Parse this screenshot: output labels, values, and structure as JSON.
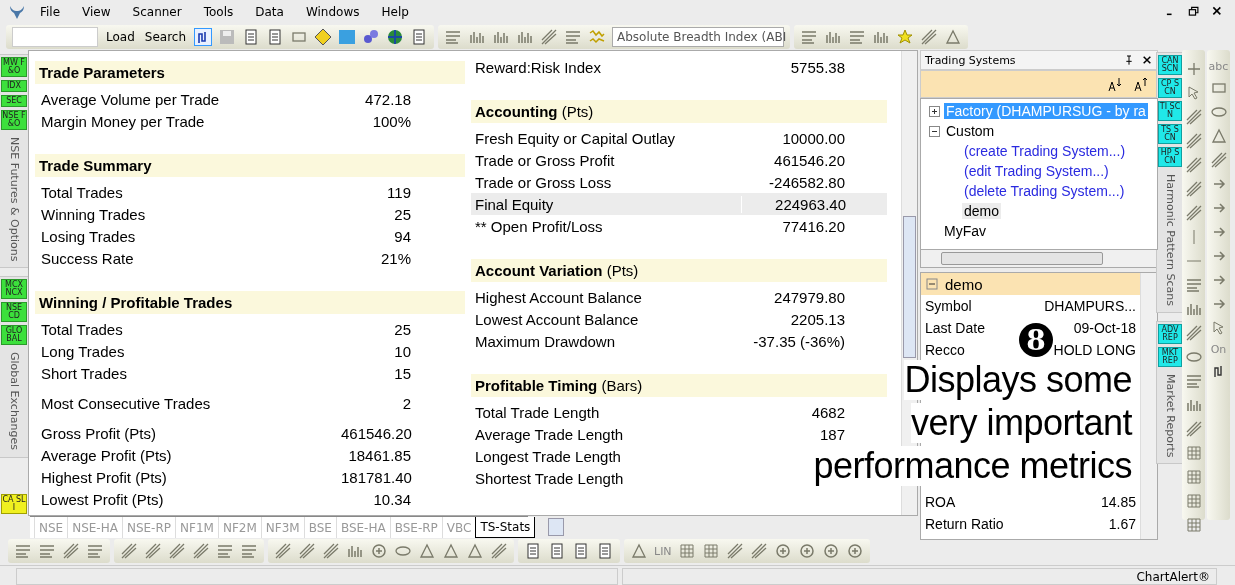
{
  "menu": {
    "items": [
      "File",
      "View",
      "Scanner",
      "Tools",
      "Data",
      "Windows",
      "Help"
    ]
  },
  "toolbar": {
    "buttons": [
      "Load",
      "Search"
    ],
    "indicator_dropdown": {
      "value": "Absolute Breadth Index (ABI"
    }
  },
  "left_strip": {
    "groups": [
      {
        "badges": [
          "MW F&O",
          "IDX",
          "SEC",
          "NSE F&O"
        ],
        "label": "NSE Futures & Options"
      },
      {
        "badges": [
          "MCX NCX",
          "NSE CD",
          "GLO BAL"
        ],
        "label": "Global Exchanges"
      }
    ],
    "bottom_badge": "CA SLI"
  },
  "stats": {
    "left": [
      {
        "title": "Trade Parameters",
        "groups": [
          [
            {
              "label": "Average Volume per Trade",
              "value": "472.18",
              "highlighted": false
            },
            {
              "label": "Margin Money per Trade",
              "value": "100%",
              "highlighted": false
            }
          ]
        ]
      },
      {
        "title": "Trade Summary",
        "groups": [
          [
            {
              "label": "Total Trades",
              "value": "119",
              "highlighted": false
            },
            {
              "label": "Winning Trades",
              "value": "25",
              "highlighted": false
            },
            {
              "label": "Losing Trades",
              "value": "94",
              "highlighted": false
            },
            {
              "label": "Success Rate",
              "value": "21%",
              "highlighted": false
            }
          ]
        ]
      },
      {
        "title": "Winning / Profitable Trades",
        "groups": [
          [
            {
              "label": "Total Trades",
              "value": "25",
              "highlighted": false
            },
            {
              "label": "Long Trades",
              "value": "10",
              "highlighted": false
            },
            {
              "label": "Short Trades",
              "value": "15",
              "highlighted": false
            }
          ],
          [
            {
              "label": "Most Consecutive Trades",
              "value": "2",
              "highlighted": false
            }
          ],
          [
            {
              "label": "Gross Profit (Pts)",
              "value": "461546.20",
              "highlighted": false
            },
            {
              "label": "Average Profit (Pts)",
              "value": "18461.85",
              "highlighted": false
            },
            {
              "label": "Highest Profit (Pts)",
              "value": "181781.40",
              "highlighted": false
            },
            {
              "label": "Lowest Profit (Pts)",
              "value": "10.34",
              "highlighted": false
            }
          ]
        ]
      }
    ],
    "right": [
      {
        "groups": [
          [
            {
              "label": "Reward:Risk Index",
              "value": "5755.38",
              "highlighted": false
            }
          ]
        ]
      },
      {
        "title": "**Accounting** (Pts)",
        "groups": [
          [
            {
              "label": "Fresh Equity or Capital Outlay",
              "value": "10000.00",
              "highlighted": false
            },
            {
              "label": "Trade or Gross Profit",
              "value": "461546.20",
              "highlighted": false
            },
            {
              "label": "Trade or Gross Loss",
              "value": "-246582.80",
              "highlighted": false
            },
            {
              "label": "Final Equity",
              "value": "224963.40",
              "highlighted": true
            },
            {
              "label": "** Open Profit/Loss",
              "value": "77416.20",
              "highlighted": false
            }
          ]
        ]
      },
      {
        "title": "**Account Variation** (Pts)",
        "groups": [
          [
            {
              "label": "Highest Account Balance",
              "value": "247979.80",
              "highlighted": false
            },
            {
              "label": "Lowest Account Balance",
              "value": "2205.13",
              "highlighted": false
            },
            {
              "label": "Maximum Drawdown",
              "value": "-37.35 (-36%)",
              "highlighted": false
            }
          ]
        ]
      },
      {
        "title": "**Profitable Timing** (Bars)",
        "groups": [
          [
            {
              "label": "Total Trade Length",
              "value": "4682",
              "highlighted": false
            },
            {
              "label": "Average Trade Length",
              "value": "187",
              "highlighted": false
            },
            {
              "label": "Longest Trade Length",
              "highlighted": false
            },
            {
              "label": "Shortest Trade Length",
              "highlighted": false
            }
          ]
        ]
      }
    ]
  },
  "tabs": [
    {
      "label": "NSE",
      "selected": false
    },
    {
      "label": "NSE-HA",
      "selected": false
    },
    {
      "label": "NSE-RP",
      "selected": false
    },
    {
      "label": "NF1M",
      "selected": false
    },
    {
      "label": "NF2M",
      "selected": false
    },
    {
      "label": "NF3M",
      "selected": false
    },
    {
      "label": "BSE",
      "selected": false
    },
    {
      "label": "BSE-HA",
      "selected": false
    },
    {
      "label": "BSE-RP",
      "selected": false
    },
    {
      "label": "VBC",
      "selected": false
    },
    {
      "label": "TS-Stats",
      "selected": true
    }
  ],
  "trading_systems": {
    "title": "Trading Systems",
    "tree": [
      {
        "label": "Factory (DHAMPURSUG - by ra",
        "kind": "folder",
        "expanded": false,
        "selected": true,
        "highlighted": false
      },
      {
        "label": "Custom",
        "kind": "folder",
        "expanded": true,
        "selected": false,
        "highlighted": false,
        "children": [
          {
            "label": "(create Trading System...)",
            "kind": "action",
            "selected": false,
            "highlighted": false
          },
          {
            "label": "(edit Trading System...)",
            "kind": "action",
            "selected": false,
            "highlighted": false
          },
          {
            "label": "(delete Trading System...)",
            "kind": "action",
            "selected": false,
            "highlighted": false
          },
          {
            "label": "demo",
            "kind": "item",
            "selected": false,
            "highlighted": true
          }
        ]
      },
      {
        "label": "MyFav",
        "kind": "item",
        "selected": false,
        "highlighted": false
      }
    ]
  },
  "details": {
    "title": "demo",
    "expanded": true,
    "rows": [
      {
        "label": "Symbol",
        "value": "DHAMPURS..."
      },
      {
        "label": "Last Date",
        "value": "09-Oct-18"
      },
      {
        "label": "Recco",
        "value": "HOLD LONG"
      }
    ],
    "rows_after": [
      {
        "label": "ROA",
        "value": "14.85"
      },
      {
        "label": "Return Ratio",
        "value": "1.67"
      }
    ]
  },
  "right_strip": {
    "groups": [
      {
        "badges": [
          "CAN SCN",
          "CP SCN",
          "TI SCN",
          "TS SCN",
          "HP SCN"
        ],
        "label": "Harmonic Pattern Scans"
      },
      {
        "badges": [
          "ADV REP",
          "MKT REP"
        ],
        "label": "Market Reports"
      }
    ]
  },
  "palette": {
    "labels": [
      "abc",
      "On"
    ]
  },
  "bottom_toolbar": {
    "labels": [
      "LIN"
    ]
  },
  "status_bar": {
    "text": "ChartAlert®"
  },
  "annotation": {
    "number": "8",
    "lines": [
      "Displays some",
      "very important",
      "performance metrics"
    ]
  }
}
